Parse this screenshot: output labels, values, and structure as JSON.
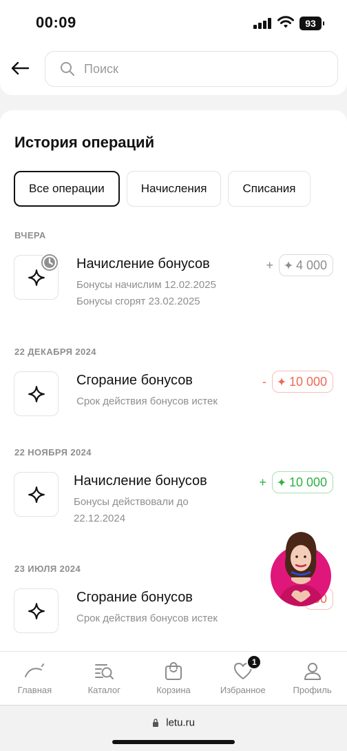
{
  "status_bar": {
    "time": "00:09",
    "battery": "93"
  },
  "search": {
    "placeholder": "Поиск"
  },
  "page": {
    "title": "История операций"
  },
  "filters": [
    "Все операции",
    "Начисления",
    "Списания"
  ],
  "sections": [
    {
      "date": "ВЧЕРА",
      "operation": {
        "title": "Начисление бонусов",
        "lines": [
          "Бонусы начислим 12.02.2025",
          "Бонусы сгорят 23.02.2025"
        ],
        "sign": "+",
        "amount": "4 000",
        "status": "pending"
      }
    },
    {
      "date": "22 ДЕКАБРЯ 2024",
      "operation": {
        "title": "Сгорание бонусов",
        "lines": [
          "Срок действия бонусов истек"
        ],
        "sign": "-",
        "amount": "10 000",
        "status": "debit"
      }
    },
    {
      "date": "22 НОЯБРЯ 2024",
      "operation": {
        "title": "Начисление бонусов",
        "lines": [
          "Бонусы действовали до",
          "22.12.2024"
        ],
        "sign": "+",
        "amount": "10 000",
        "status": "credit"
      }
    },
    {
      "date": "23 ИЮЛЯ 2024",
      "operation": {
        "title": "Сгорание бонусов",
        "lines": [
          "Срок действия бонусов истек"
        ],
        "sign": "-",
        "amount": "00",
        "status": "debit"
      }
    }
  ],
  "bottom_nav": [
    {
      "label": "Главная",
      "icon": "home-arc-icon"
    },
    {
      "label": "Каталог",
      "icon": "catalog-search-icon"
    },
    {
      "label": "Корзина",
      "icon": "bag-icon"
    },
    {
      "label": "Избранное",
      "icon": "heart-icon",
      "badge": "1"
    },
    {
      "label": "Профиль",
      "icon": "profile-icon"
    }
  ],
  "browser": {
    "url": "letu.ru"
  },
  "colors": {
    "credit": "#2fb142",
    "debit": "#ee6a55",
    "pending": "#8e8e8e",
    "accent": "#e0177a"
  }
}
